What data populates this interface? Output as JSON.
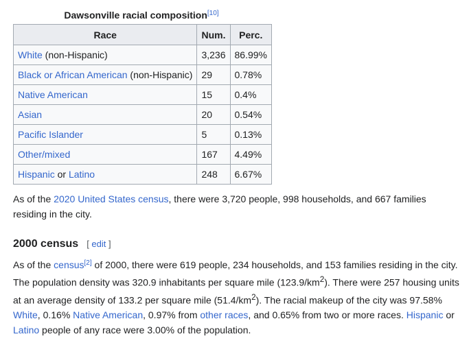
{
  "table": {
    "caption": "Dawsonville racial composition",
    "caption_ref": "[10]",
    "headers": {
      "race": "Race",
      "num": "Num.",
      "perc": "Perc."
    },
    "rows": [
      {
        "race_link": "White",
        "race_extra": " (non-Hispanic)",
        "num": "3,236",
        "perc": "86.99%"
      },
      {
        "race_link": "Black or African American",
        "race_extra": " (non-Hispanic)",
        "num": "29",
        "perc": "0.78%"
      },
      {
        "race_link": "Native American",
        "race_extra": "",
        "num": "15",
        "perc": "0.4%"
      },
      {
        "race_link": "Asian",
        "race_extra": "",
        "num": "20",
        "perc": "0.54%"
      },
      {
        "race_link": "Pacific Islander",
        "race_extra": "",
        "num": "5",
        "perc": "0.13%"
      },
      {
        "race_link": "Other/mixed",
        "race_extra": "",
        "num": "167",
        "perc": "4.49%"
      },
      {
        "race_link": "Hispanic",
        "race_middle": " or ",
        "race_link2": "Latino",
        "race_extra": "",
        "num": "248",
        "perc": "6.67%"
      }
    ]
  },
  "census2020": {
    "t1": "As of the ",
    "link": "2020 United States census",
    "t2": ", there were 3,720 people, 998 households, and 667 families residing in the city."
  },
  "section": {
    "title": "2000 census",
    "edit_open": "[ ",
    "edit_label": "edit",
    "edit_close": " ]"
  },
  "census2000": {
    "t1": "As of the ",
    "link_census": "census",
    "ref": "[2]",
    "t2": " of 2000, there were 619 people, 234 households, and 153 families residing in the city. The population density was 320.9 inhabitants per square mile (123.9/km",
    "sup1": "2",
    "t3": "). There were 257 housing units at an average density of 133.2 per square mile (51.4/km",
    "sup2": "2",
    "t4": "). The racial makeup of the city was 97.58% ",
    "link_white": "White",
    "t5": ", 0.16% ",
    "link_native": "Native American",
    "t6": ", 0.97% from ",
    "link_other": "other races",
    "t7": ", and 0.65% from two or more races. ",
    "link_hispanic": "Hispanic",
    "t8": " or ",
    "link_latino": "Latino",
    "t9": " people of any race were 3.00% of the population."
  }
}
